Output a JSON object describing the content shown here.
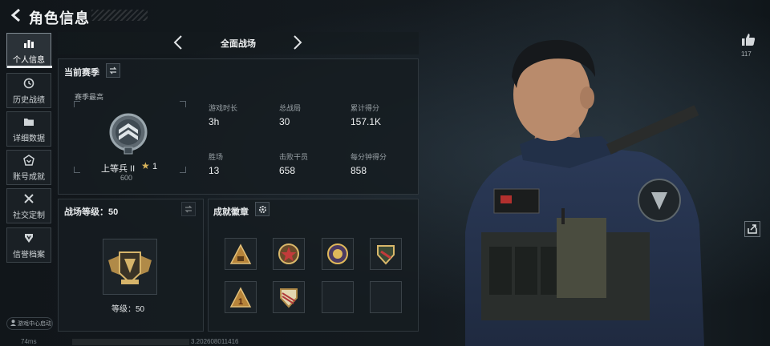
{
  "header": {
    "title": "角色信息"
  },
  "sidebar": {
    "items": [
      {
        "label": "个人信息",
        "icon": "bar-chart-icon",
        "active": true
      },
      {
        "label": "历史战绩",
        "icon": "history-icon"
      },
      {
        "label": "详细数据",
        "icon": "folder-icon"
      },
      {
        "label": "账号成就",
        "icon": "achievement-icon"
      },
      {
        "label": "社交定制",
        "icon": "tools-icon"
      },
      {
        "label": "信誉档案",
        "icon": "shield-icon"
      }
    ],
    "game_center_label": "游戏中心启动"
  },
  "status_bar": {
    "ping": "74ms",
    "uid": "3.202608011416"
  },
  "mode_selector": {
    "current": "全面战场"
  },
  "season_panel": {
    "title": "当前赛季",
    "subtitle": "赛季最高",
    "rank_name": "上等兵 II",
    "rank_stars": "1",
    "rank_points": "600",
    "stats": [
      {
        "label": "游戏时长",
        "value": "3h"
      },
      {
        "label": "总战局",
        "value": "30"
      },
      {
        "label": "累计得分",
        "value": "157.1K"
      },
      {
        "label": "胜场",
        "value": "13"
      },
      {
        "label": "击败干员",
        "value": "658"
      },
      {
        "label": "每分钟得分",
        "value": "858"
      }
    ]
  },
  "battlefield_level_panel": {
    "title": "战场等级：50",
    "level_label": "等级：50"
  },
  "achievements_panel": {
    "title": "成就徽章",
    "badges": [
      {
        "icon": "pyramid-badge-icon"
      },
      {
        "icon": "red-star-medal-icon"
      },
      {
        "icon": "gold-emblem-badge-icon"
      },
      {
        "icon": "crest-badge-icon"
      },
      {
        "icon": "number-one-badge-icon"
      },
      {
        "icon": "striped-crest-badge-icon"
      },
      {
        "icon": "empty-slot"
      },
      {
        "icon": "empty-slot"
      }
    ]
  },
  "right_actions": {
    "like_count": "117"
  },
  "colors": {
    "accent": "#e7eaec",
    "gold": "#d8b35a",
    "panel_bg": "#161c21"
  }
}
